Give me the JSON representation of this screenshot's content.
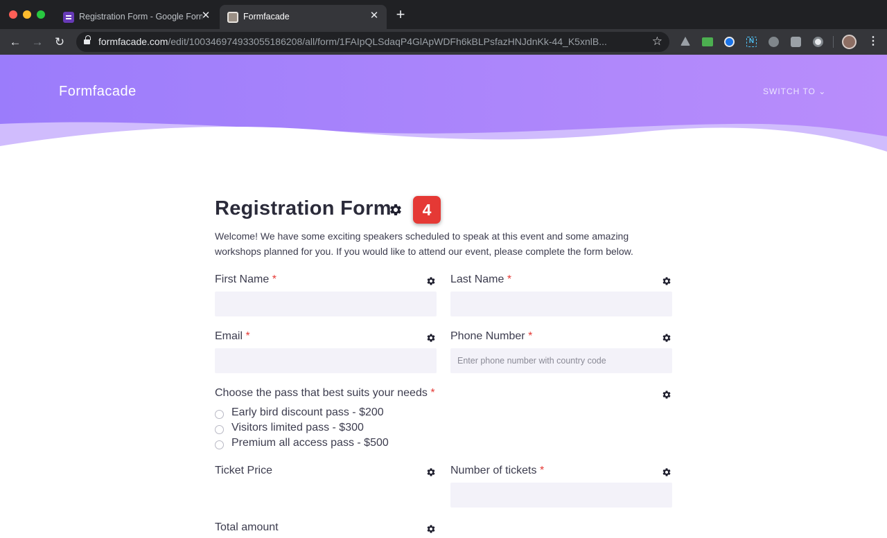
{
  "browser": {
    "tabs": [
      {
        "title": "Registration Form - Google Forms",
        "active": false,
        "icon": "google-forms-icon"
      },
      {
        "title": "Formfacade",
        "active": true,
        "icon": "formfacade-icon"
      }
    ],
    "close_glyph": "✕",
    "new_tab_glyph": "+",
    "nav": {
      "back": "←",
      "forward": "→",
      "reload": "↻",
      "menu": "⋮",
      "star": "☆"
    },
    "url_host": "formfacade.com",
    "url_path": "/edit/100346974933055186208/all/form/1FAIpQLSdaqP4GlApWDFh6kBLPsfazHNJdnKk-44_K5xnlB...",
    "extensions": [
      "drive-icon",
      "mail-icon",
      "compass-icon",
      "n-icon",
      "u-icon",
      "chat-icon",
      "circle-icon"
    ],
    "extension_n_label": "N"
  },
  "header": {
    "brand": "Formfacade",
    "switch_to": "SWITCH TO ⌄",
    "gradient_from": "#9b7cfb",
    "gradient_to": "#bb8efa"
  },
  "form": {
    "title": "Registration Form",
    "badge": "4",
    "description": "Welcome! We have some exciting speakers scheduled to speak at this event and some amazing workshops planned for you. If you would like to attend our event, please complete the form below.",
    "required_mark": "*",
    "fields": {
      "first_name": {
        "label": "First Name",
        "value": ""
      },
      "last_name": {
        "label": "Last Name",
        "value": ""
      },
      "email": {
        "label": "Email",
        "value": ""
      },
      "phone": {
        "label": "Phone Number",
        "placeholder": "Enter phone number with country code",
        "value": ""
      },
      "pass": {
        "label": "Choose the pass that best suits your needs",
        "options": [
          "Early bird discount pass - $200",
          "Visitors limited pass - $300",
          "Premium all access pass - $500"
        ]
      },
      "ticket_price": {
        "label": "Ticket Price"
      },
      "num_tickets": {
        "label": "Number of tickets",
        "value": ""
      },
      "total_amount": {
        "label": "Total amount"
      }
    }
  },
  "colors": {
    "accent": "#9b7cfb",
    "required": "#e53935",
    "badge": "#e53935",
    "input_bg": "#f3f2f9"
  }
}
